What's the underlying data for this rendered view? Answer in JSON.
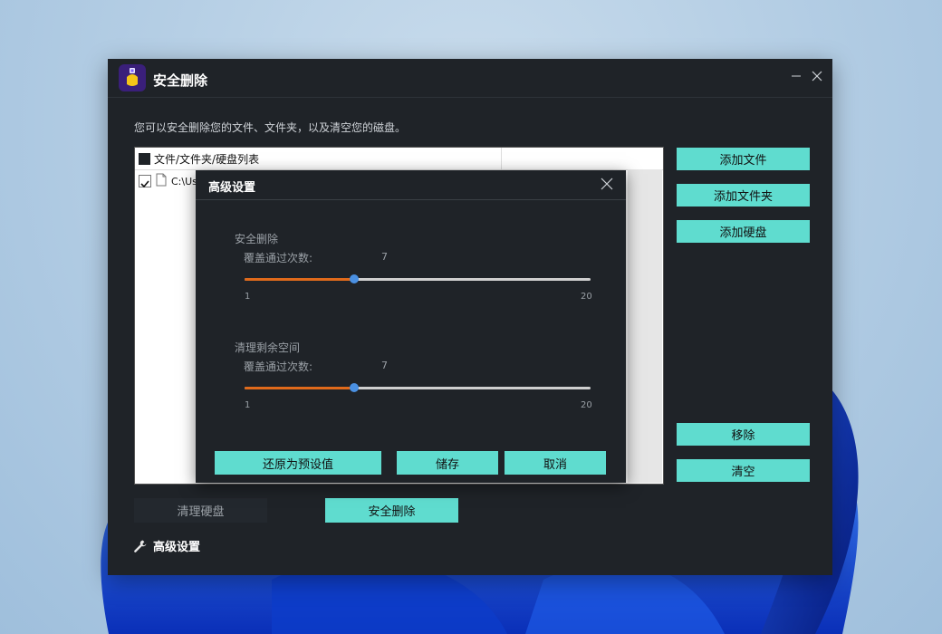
{
  "window": {
    "title": "安全删除"
  },
  "description": "您可以安全删除您的文件、文件夹，以及清空您的磁盘。",
  "list": {
    "header": "文件/文件夹/硬盘列表",
    "rows": [
      {
        "path": "C:\\Us",
        "checked": true
      }
    ]
  },
  "side_buttons": {
    "add_file": "添加文件",
    "add_folder": "添加文件夹",
    "add_disk": "添加硬盘",
    "remove": "移除",
    "clear": "清空"
  },
  "bottom": {
    "wipe_disk": "清理硬盘",
    "secure_delete": "安全删除",
    "advanced": "高级设置"
  },
  "dialog": {
    "title": "高级设置",
    "secure_delete": {
      "section": "安全删除",
      "label": "覆盖通过次数:",
      "value": 7,
      "value_text": "7",
      "min": 1,
      "max": 20,
      "min_text": "1",
      "max_text": "20"
    },
    "wipe_free_space": {
      "section": "清理剩余空间",
      "label": "覆盖通过次数:",
      "value": 7,
      "value_text": "7",
      "min": 1,
      "max": 20,
      "min_text": "1",
      "max_text": "20"
    },
    "buttons": {
      "restore": "还原为预设值",
      "save": "储存",
      "cancel": "取消"
    }
  },
  "colors": {
    "accent_button": "#5fdccf",
    "slider_fill": "#e06a1b",
    "slider_thumb": "#4a90e2",
    "window_bg": "#1f2328"
  }
}
